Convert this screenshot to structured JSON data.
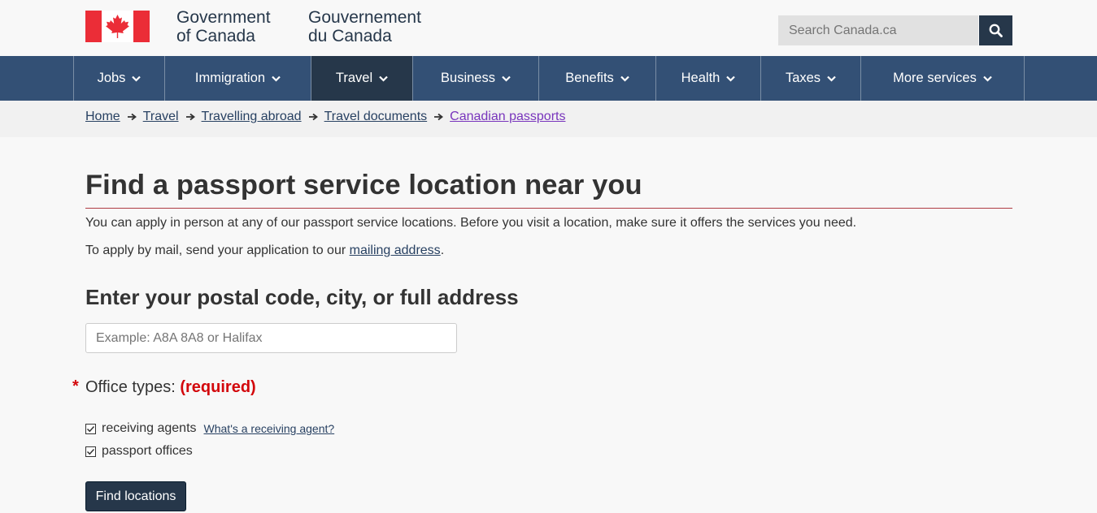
{
  "header": {
    "signature_en": [
      "Government",
      "of Canada"
    ],
    "signature_fr": [
      "Gouvernement",
      "du Canada"
    ],
    "search_placeholder": "Search Canada.ca",
    "colors": {
      "flag_red": "#eb2d37",
      "nav_bg": "#335075",
      "nav_active": "#26374a"
    }
  },
  "nav": {
    "items": [
      {
        "label": "Jobs"
      },
      {
        "label": "Immigration"
      },
      {
        "label": "Travel",
        "active": true
      },
      {
        "label": "Business"
      },
      {
        "label": "Benefits"
      },
      {
        "label": "Health"
      },
      {
        "label": "Taxes"
      },
      {
        "label": "More services"
      }
    ]
  },
  "breadcrumb": [
    "Home",
    "Travel",
    "Travelling abroad",
    "Travel documents",
    "Canadian passports"
  ],
  "main": {
    "title": "Find a passport service location near you",
    "intro": "You can apply in person at any of our passport service locations. Before you visit a location, make sure it offers the services you need.",
    "mail_prefix": "To apply by mail, send your application to our ",
    "mail_link": "mailing address",
    "mail_suffix": ".",
    "address_heading": "Enter your postal code, city, or full address",
    "address_placeholder": "Example: A8A 8A8 or Halifax",
    "required_star": "*",
    "office_types_label": "Office types:",
    "required_label": "(required)",
    "options": [
      {
        "label": "receiving agents",
        "checked": true,
        "help": "What's a receiving agent?"
      },
      {
        "label": "passport offices",
        "checked": true
      }
    ],
    "submit_label": "Find locations"
  }
}
